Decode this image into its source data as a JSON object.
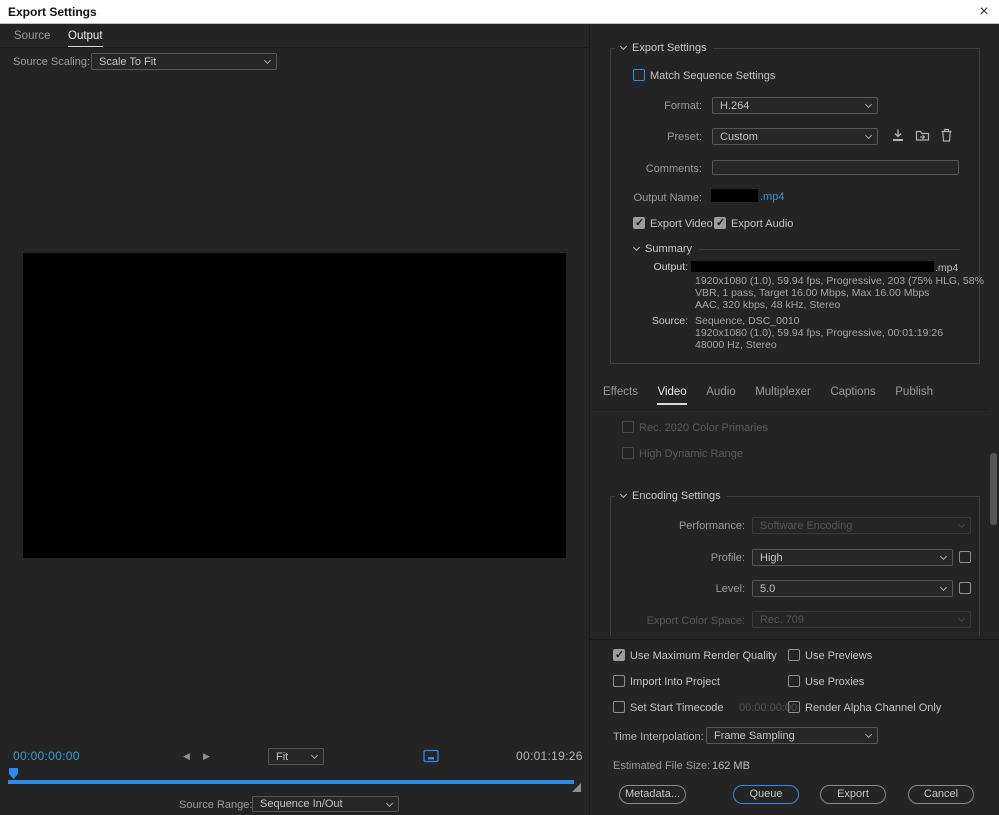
{
  "window": {
    "title": "Export Settings",
    "close": "×"
  },
  "colors": {
    "accent": "#2d8ceb",
    "link": "#3a8fd9",
    "timecode": "#3f9bdc"
  },
  "icons": {
    "prev": "◀",
    "next": "▶"
  },
  "left": {
    "tabs": [
      {
        "label": "Source"
      },
      {
        "label": "Output"
      }
    ],
    "source_scaling_label": "Source Scaling:",
    "source_scaling_value": "Scale To Fit",
    "current_timecode": "00:00:00:00",
    "duration_timecode": "00:01:19:26",
    "zoom_value": "Fit",
    "source_range_label": "Source Range:",
    "source_range_value": "Sequence In/Out"
  },
  "export": {
    "header": "Export Settings",
    "match_sequence": {
      "label": "Match Sequence Settings",
      "checked": "false"
    },
    "format_label": "Format:",
    "format_value": "H.264",
    "preset_label": "Preset:",
    "preset_value": "Custom",
    "comments_label": "Comments:",
    "comments_value": "",
    "output_name_label": "Output Name:",
    "output_name_ext": ".mp4",
    "export_video": {
      "label": "Export Video",
      "checked": "true"
    },
    "export_audio": {
      "label": "Export Audio",
      "checked": "true"
    },
    "summary": {
      "header": "Summary",
      "output_label": "Output:",
      "output_ext": ".mp4",
      "output_lines": [
        "1920x1080 (1.0), 59.94 fps, Progressive, 203 (75% HLG, 58%",
        "VBR, 1 pass, Target 16.00 Mbps, Max 16.00 Mbps",
        "AAC, 320 kbps, 48 kHz, Stereo"
      ],
      "source_label": "Source:",
      "source_name": "Sequence, DSC_0010",
      "source_lines": [
        "1920x1080 (1.0), 59.94 fps, Progressive, 00:01:19:26",
        "48000 Hz, Stereo"
      ]
    }
  },
  "tabs": [
    {
      "label": "Effects"
    },
    {
      "label": "Video"
    },
    {
      "label": "Audio"
    },
    {
      "label": "Multiplexer"
    },
    {
      "label": "Captions"
    },
    {
      "label": "Publish"
    }
  ],
  "video_tab": {
    "rec2020": {
      "label": "Rec. 2020 Color Primaries",
      "checked": "false"
    },
    "hdr": {
      "label": "High Dynamic Range",
      "checked": "false"
    },
    "encoding": {
      "header": "Encoding Settings",
      "performance_label": "Performance:",
      "performance_value": "Software Encoding",
      "profile_label": "Profile:",
      "profile_value": "High",
      "profile_checked": "false",
      "level_label": "Level:",
      "level_value": "5.0",
      "level_checked": "false",
      "colorspace_label": "Export Color Space:",
      "colorspace_value": "Rec. 709"
    }
  },
  "footer": {
    "options": [
      {
        "label": "Use Maximum Render Quality",
        "checked": "true"
      },
      {
        "label": "Use Previews",
        "checked": "false"
      },
      {
        "label": "Import Into Project",
        "checked": "false"
      },
      {
        "label": "Use Proxies",
        "checked": "false"
      },
      {
        "label": "Set Start Timecode",
        "checked": "false",
        "extra": "00:00:00:00"
      },
      {
        "label": "Render Alpha Channel Only",
        "checked": "false"
      }
    ],
    "time_interpolation_label": "Time Interpolation:",
    "time_interpolation_value": "Frame Sampling",
    "estimated_label": "Estimated File Size:",
    "estimated_value": "162 MB",
    "buttons": {
      "metadata": "Metadata...",
      "queue": "Queue",
      "export": "Export",
      "cancel": "Cancel"
    }
  }
}
